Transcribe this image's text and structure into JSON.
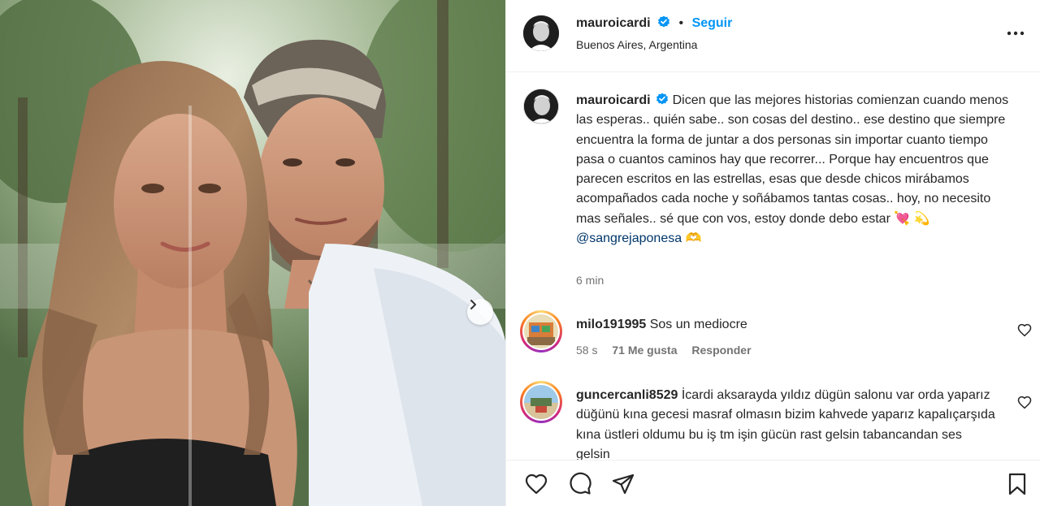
{
  "post": {
    "author": "mauroicardi",
    "follow_label": "Seguir",
    "separator": "•",
    "location": "Buenos Aires, Argentina",
    "caption": "Dicen que las mejores historias comienzan cuando menos las esperas.. quién sabe.. son cosas del destino.. ese destino que siempre encuentra la forma de juntar a dos personas sin importar cuanto tiempo pasa o cuantos caminos hay que recorrer... Porque hay encuentros que parecen escritos en las estrellas, esas que desde chicos mirábamos acompañados cada noche y soñábamos tantas cosas.. hoy, no necesito mas señales.. sé que con vos, estoy donde debo estar",
    "caption_emoji": "💘 💫",
    "mention": "@sangrejaponesa",
    "mention_emoji": "🫶",
    "time": "6 min"
  },
  "comments": [
    {
      "user": "milo191995",
      "text": "Sos un mediocre",
      "time": "58 s",
      "likes": "71 Me gusta",
      "reply": "Responder"
    },
    {
      "user": "guncercanli8529",
      "text": "İcardi aksarayda yıldız dügün salonu var orda yaparız düğünü kına gecesi masraf olmasın bizim kahvede yaparız kapalıçarşıda kına üstleri oldumu bu iş tm işin gücün rast gelsin tabancandan ses gelsin"
    }
  ],
  "icons": {
    "verified": "verified-badge-icon",
    "more": "more-options-icon",
    "heart": "heart-icon",
    "like": "like-icon",
    "comment": "comment-icon",
    "share": "share-icon",
    "save": "bookmark-icon",
    "next": "chevron-right-icon"
  },
  "colors": {
    "accent": "#0095f6",
    "text": "#262626",
    "muted": "#737373",
    "mention": "#00376b",
    "border": "#efefef"
  }
}
